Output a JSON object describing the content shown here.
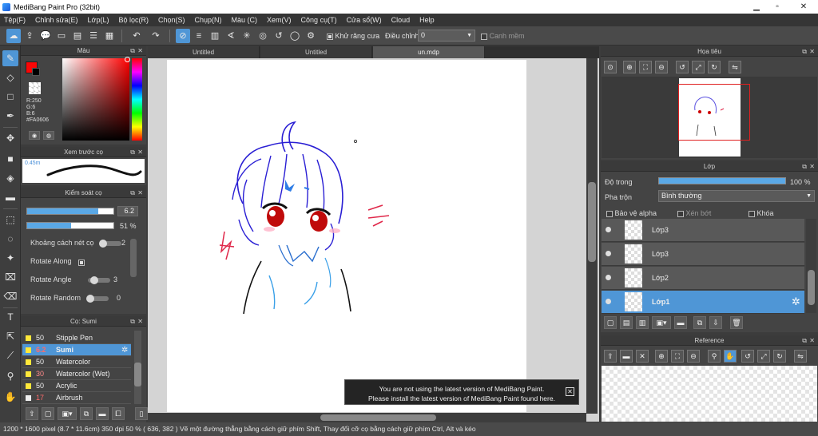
{
  "window": {
    "title": "MediBang Paint Pro (32bit)"
  },
  "menu": [
    "Tệp(F)",
    "Chỉnh sửa(E)",
    "Lớp(L)",
    "Bộ lọc(R)",
    "Chọn(S)",
    "Chụp(N)",
    "Màu (C)",
    "Xem(V)",
    "Công cụ(T)",
    "Cửa sổ(W)",
    "Cloud",
    "Help"
  ],
  "toolbar": {
    "antialias_label": "Khử răng cưa",
    "adjust_label": "Điều chỉnh",
    "adjust_value": "0",
    "snap_label": "Canh mềm"
  },
  "color_panel": {
    "title": "Màu",
    "r": "R:250",
    "g": "G:6",
    "b": "B:6",
    "hex": "#FA0606",
    "primary_color": "#FA0606"
  },
  "brush_preview": {
    "title": "Xem trước cọ",
    "size": "0.45m"
  },
  "brush_control": {
    "title": "Kiểm soát cọ",
    "size_value": "6.2",
    "size_fraction": 0.82,
    "opacity_value": "51 %",
    "opacity_fraction": 0.51,
    "spacing_label": "Khoảng cách nét cọ",
    "spacing_value": "2",
    "rotate_along_label": "Rotate Along",
    "rotate_angle_label": "Rotate Angle",
    "rotate_angle_value": "3",
    "rotate_random_label": "Rotate Random",
    "rotate_random_value": "0"
  },
  "brush_list": {
    "title": "Cọ: Sumi",
    "items": [
      {
        "size": "50",
        "name": "Stipple Pen"
      },
      {
        "size": "6.2",
        "name": "Sumi"
      },
      {
        "size": "50",
        "name": "Watercolor"
      },
      {
        "size": "30",
        "name": "Watercolor (Wet)"
      },
      {
        "size": "50",
        "name": "Acrylic"
      },
      {
        "size": "17",
        "name": "Airbrush"
      }
    ]
  },
  "tabs": [
    "Untitled",
    "Untitled",
    "un.mdp"
  ],
  "navigator": {
    "title": "Họa tiêu"
  },
  "layers_panel": {
    "title": "Lớp",
    "opacity_label": "Độ trong",
    "opacity_value": "100 %",
    "opacity_fraction": 1.0,
    "blend_label": "Pha trộn",
    "blend_value": "Bình thường",
    "protect_alpha_label": "Bảo vệ alpha",
    "clip_label": "Xén bớt",
    "lock_label": "Khóa",
    "layers": [
      "Lớp3",
      "Lớp3",
      "Lớp2",
      "Lớp1"
    ]
  },
  "reference": {
    "title": "Reference"
  },
  "notice": {
    "line1": "You are not using the latest version of MediBang Paint.",
    "line2": "Please install the latest version of MediBang Paint found here."
  },
  "status": {
    "text": "1200 * 1600 pixel   (8.7 * 11.6cm)   350 dpi   50 %   ( 636, 382 )   Vẽ một đường thẳng bằng cách giữ phím Shift, Thay đổi cỡ cọ bằng cách giữ phím Ctrl, Alt và kéo"
  }
}
